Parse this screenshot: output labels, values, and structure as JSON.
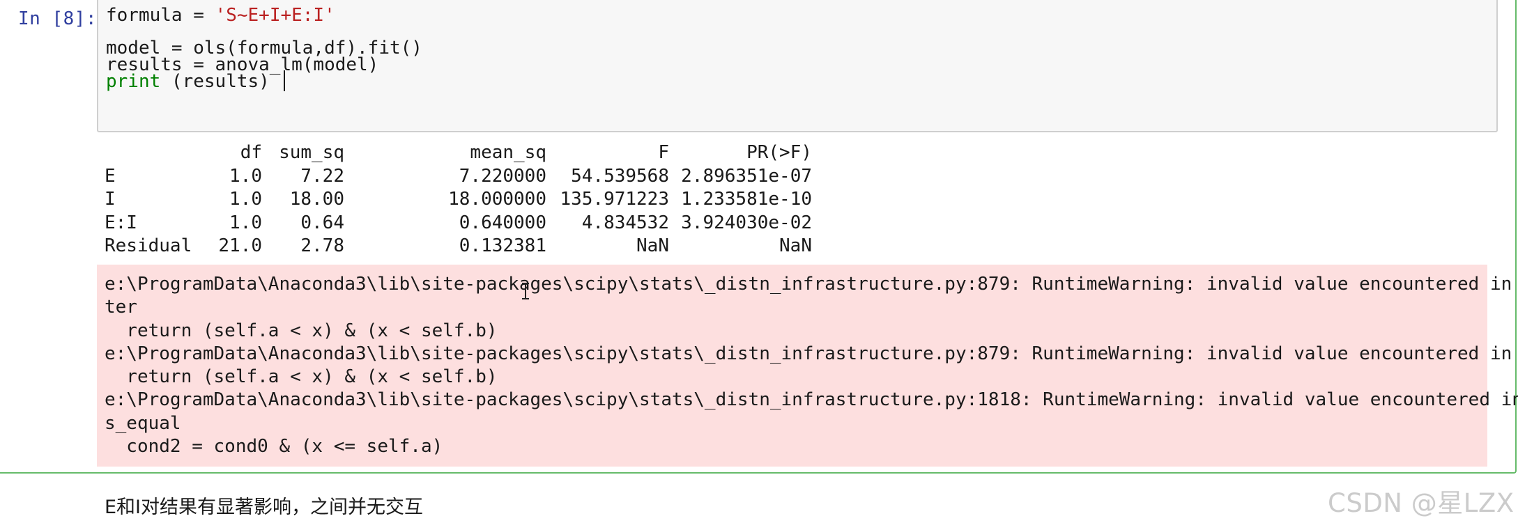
{
  "cell": {
    "prompt": "In [8]:",
    "code": {
      "line1_pre": "formula = ",
      "line1_str": "'S~E+I+E:I'",
      "line2": "",
      "line3": "model = ols(formula,df).fit()",
      "line4": "results = anova_lm(model)",
      "line5_builtin": "print",
      "line5_rest": " (results)"
    },
    "output_table": {
      "headers": [
        "",
        "df",
        "sum_sq",
        "mean_sq",
        "F",
        "PR(>F)"
      ],
      "rows": [
        [
          "E",
          "1.0",
          "7.22",
          "7.220000",
          "54.539568",
          "2.896351e-07"
        ],
        [
          "I",
          "1.0",
          "18.00",
          "18.000000",
          "135.971223",
          "1.233581e-10"
        ],
        [
          "E:I",
          "1.0",
          "0.64",
          "0.640000",
          "4.834532",
          "3.924030e-02"
        ],
        [
          "Residual",
          "21.0",
          "2.78",
          "0.132381",
          "NaN",
          "NaN"
        ]
      ]
    },
    "stderr_lines": [
      "e:\\ProgramData\\Anaconda3\\lib\\site-packages\\scipy\\stats\\_distn_infrastructure.py:879: RuntimeWarning: invalid value encountered in grea",
      "ter",
      "  return (self.a < x) & (x < self.b)",
      "e:\\ProgramData\\Anaconda3\\lib\\site-packages\\scipy\\stats\\_distn_infrastructure.py:879: RuntimeWarning: invalid value encountered in less",
      "  return (self.a < x) & (x < self.b)",
      "e:\\ProgramData\\Anaconda3\\lib\\site-packages\\scipy\\stats\\_distn_infrastructure.py:1818: RuntimeWarning: invalid value encountered in les",
      "s_equal",
      "  cond2 = cond0 & (x <= self.a)"
    ]
  },
  "markdown": {
    "text": "E和I对结果有显著影响，之间并无交互"
  },
  "watermark": "CSDN @星LZX",
  "colors": {
    "prompt": "#303f9f",
    "string": "#ba2121",
    "builtin": "#008000",
    "stderr_bg": "#fddfdf",
    "cell_border": "#66bb6a"
  }
}
